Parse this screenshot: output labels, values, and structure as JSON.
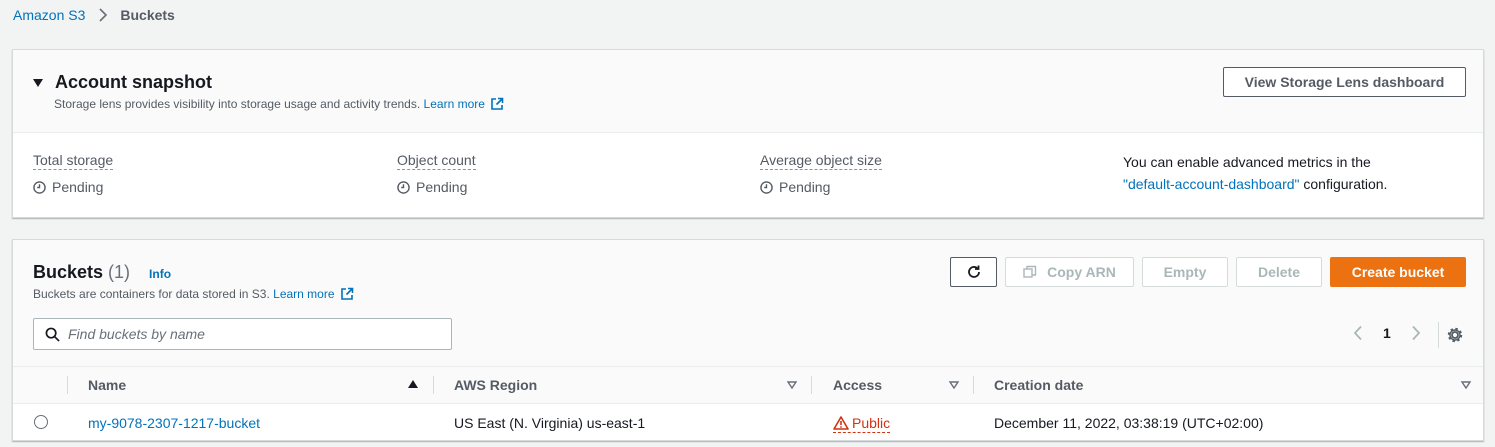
{
  "breadcrumb": {
    "root": "Amazon S3",
    "current": "Buckets"
  },
  "snapshot": {
    "title": "Account snapshot",
    "description": "Storage lens provides visibility into storage usage and activity trends.",
    "learn_more": "Learn more",
    "view_button": "View Storage Lens dashboard",
    "metrics": [
      {
        "label": "Total storage",
        "value": "Pending"
      },
      {
        "label": "Object count",
        "value": "Pending"
      },
      {
        "label": "Average object size",
        "value": "Pending"
      }
    ],
    "advanced": {
      "line1": "You can enable advanced metrics in the",
      "link": "\"default-account-dashboard\"",
      "suffix": "configuration."
    }
  },
  "buckets": {
    "title": "Buckets",
    "count": "(1)",
    "info": "Info",
    "description": "Buckets are containers for data stored in S3.",
    "learn_more": "Learn more",
    "buttons": {
      "copy_arn": "Copy ARN",
      "empty": "Empty",
      "delete": "Delete",
      "create": "Create bucket"
    },
    "search_placeholder": "Find buckets by name",
    "page": "1",
    "columns": {
      "name": "Name",
      "region": "AWS Region",
      "access": "Access",
      "created": "Creation date"
    },
    "rows": [
      {
        "name": "my-9078-2307-1217-bucket",
        "region": "US East (N. Virginia) us-east-1",
        "access": "Public",
        "created": "December 11, 2022, 03:38:19 (UTC+02:00)"
      }
    ]
  },
  "colors": {
    "link": "#0073bb",
    "primary": "#ec7211",
    "danger": "#d13212"
  }
}
